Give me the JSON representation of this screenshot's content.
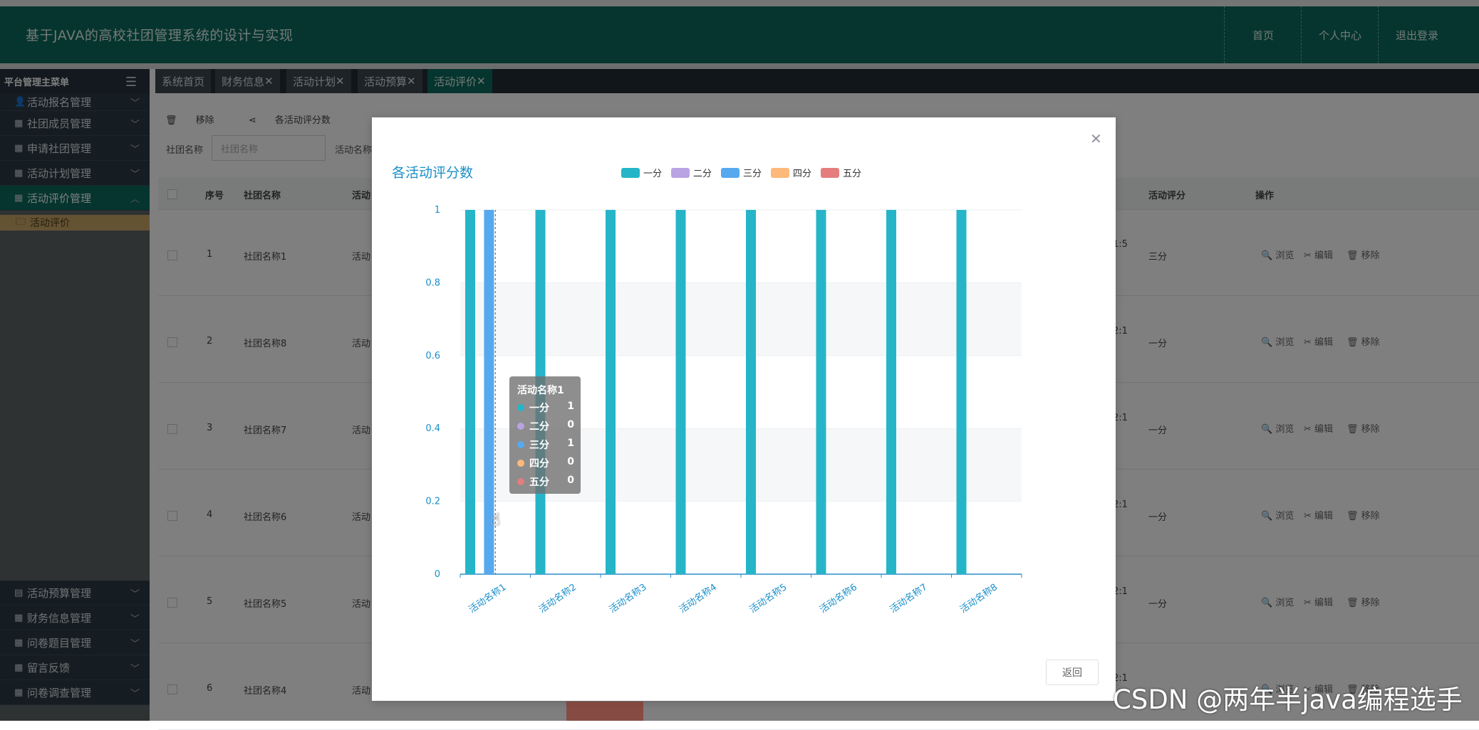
{
  "header": {
    "title": "基于JAVA的高校社团管理系统的设计与实现",
    "nav": [
      "首页",
      "个人中心",
      "退出登录"
    ]
  },
  "sidebar": {
    "title": "平台管理主菜单",
    "items": [
      {
        "label": "活动报名管理",
        "icon": "user-icon"
      },
      {
        "label": "社团成员管理",
        "icon": "grid-icon"
      },
      {
        "label": "申请社团管理",
        "icon": "grid-icon"
      },
      {
        "label": "活动计划管理",
        "icon": "grid-icon"
      },
      {
        "label": "活动评价管理",
        "icon": "grid-icon",
        "active": true
      }
    ],
    "sub_item": "活动评价",
    "bottom_items": [
      {
        "label": "活动预算管理",
        "icon": "clipboard-icon"
      },
      {
        "label": "财务信息管理",
        "icon": "grid-icon"
      },
      {
        "label": "问卷题目管理",
        "icon": "grid-icon"
      },
      {
        "label": "留言反馈",
        "icon": "grid-icon"
      },
      {
        "label": "问卷调查管理",
        "icon": "grid-icon"
      }
    ]
  },
  "tabs": [
    "系统首页",
    "财务信息",
    "活动计划",
    "活动预算",
    "活动评价"
  ],
  "toolbar": {
    "remove": "移除",
    "chart": "各活动评分数"
  },
  "search": {
    "label1": "社团名称",
    "placeholder": "社团名称",
    "label2": "活动名称"
  },
  "table": {
    "headers": [
      "序号",
      "社团名称",
      "活动",
      "活动评分",
      "操作"
    ],
    "rows": [
      {
        "no": "1",
        "club": "社团名称1",
        "act": "活动",
        "score": "三分",
        "tail": "1:5"
      },
      {
        "no": "2",
        "club": "社团名称8",
        "act": "活动",
        "score": "一分",
        "tail": "2:1"
      },
      {
        "no": "3",
        "club": "社团名称7",
        "act": "活动",
        "score": "一分",
        "tail": "2:1"
      },
      {
        "no": "4",
        "club": "社团名称6",
        "act": "活动",
        "score": "一分",
        "tail": "2:1"
      },
      {
        "no": "5",
        "club": "社团名称5",
        "act": "活动",
        "score": "一分",
        "tail": "2:1"
      },
      {
        "no": "6",
        "club": "社团名称4",
        "act": "活动",
        "score": "",
        "tail": "2:1"
      }
    ],
    "ops": [
      "浏览",
      "编辑",
      "移除"
    ]
  },
  "dialog": {
    "return_label": "返回"
  },
  "chart_data": {
    "type": "bar",
    "title": "各活动评分数",
    "categories": [
      "活动名称1",
      "活动名称2",
      "活动名称3",
      "活动名称4",
      "活动名称5",
      "活动名称6",
      "活动名称7",
      "活动名称8"
    ],
    "series": [
      {
        "name": "一分",
        "color": "#26b5c8",
        "values": [
          1,
          1,
          1,
          1,
          1,
          1,
          1,
          1
        ]
      },
      {
        "name": "二分",
        "color": "#b9a3e3",
        "values": [
          0,
          0,
          0,
          0,
          0,
          0,
          0,
          0
        ]
      },
      {
        "name": "三分",
        "color": "#56a9ee",
        "values": [
          1,
          0,
          0,
          0,
          0,
          0,
          0,
          0
        ]
      },
      {
        "name": "四分",
        "color": "#fdb97b",
        "values": [
          0,
          0,
          0,
          0,
          0,
          0,
          0,
          0
        ]
      },
      {
        "name": "五分",
        "color": "#e57d7d",
        "values": [
          0,
          0,
          0,
          0,
          0,
          0,
          0,
          0
        ]
      }
    ],
    "yticks": [
      "0",
      "0.2",
      "0.4",
      "0.6",
      "0.8",
      "1"
    ],
    "ylim": [
      0,
      1
    ],
    "legend": "top-center",
    "tooltip": {
      "title": "活动名称1",
      "rows": [
        {
          "name": "一分",
          "value": "1",
          "color": "#26b5c8"
        },
        {
          "name": "二分",
          "value": "0",
          "color": "#b9a3e3"
        },
        {
          "name": "三分",
          "value": "1",
          "color": "#56a9ee"
        },
        {
          "name": "四分",
          "value": "0",
          "color": "#fdb97b"
        },
        {
          "name": "五分",
          "value": "0",
          "color": "#e57d7d"
        }
      ]
    }
  },
  "watermark": "CSDN @两年半java编程选手"
}
